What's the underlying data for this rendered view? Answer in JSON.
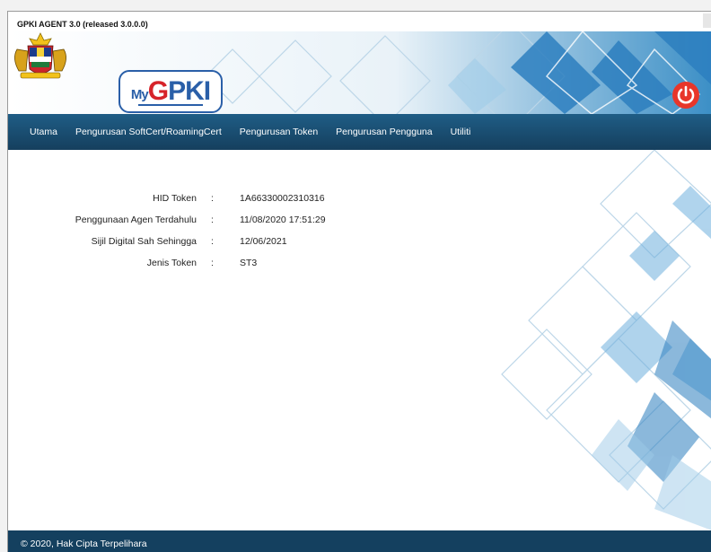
{
  "window": {
    "title": "GPKI AGENT 3.0 (released 3.0.0.0)"
  },
  "header": {
    "logo_my": "My",
    "logo_g": "G",
    "logo_pki": "PKI"
  },
  "nav": {
    "items": [
      {
        "label": "Utama"
      },
      {
        "label": "Pengurusan SoftCert/RoamingCert"
      },
      {
        "label": "Pengurusan Token"
      },
      {
        "label": "Pengurusan Pengguna"
      },
      {
        "label": "Utiliti"
      }
    ]
  },
  "token_info": {
    "rows": [
      {
        "label": "HID Token",
        "colon": ":",
        "value": "1A66330002310316"
      },
      {
        "label": "Penggunaan Agen Terdahulu",
        "colon": ":",
        "value": "11/08/2020 17:51:29"
      },
      {
        "label": "Sijil Digital Sah Sehingga",
        "colon": ":",
        "value": "12/06/2021"
      },
      {
        "label": "Jenis Token",
        "colon": ":",
        "value": "ST3"
      }
    ]
  },
  "footer": {
    "copyright": "© 2020, Hak Cipta Terpelihara"
  },
  "colors": {
    "nav_bg": "#1a4e73",
    "footer_bg": "#14405f",
    "power_button": "#e8362a",
    "logo_blue": "#2a5fa8",
    "logo_red": "#d6232a"
  },
  "icons": {
    "power": "power-icon",
    "crest": "malaysia-coat-of-arms-icon"
  }
}
